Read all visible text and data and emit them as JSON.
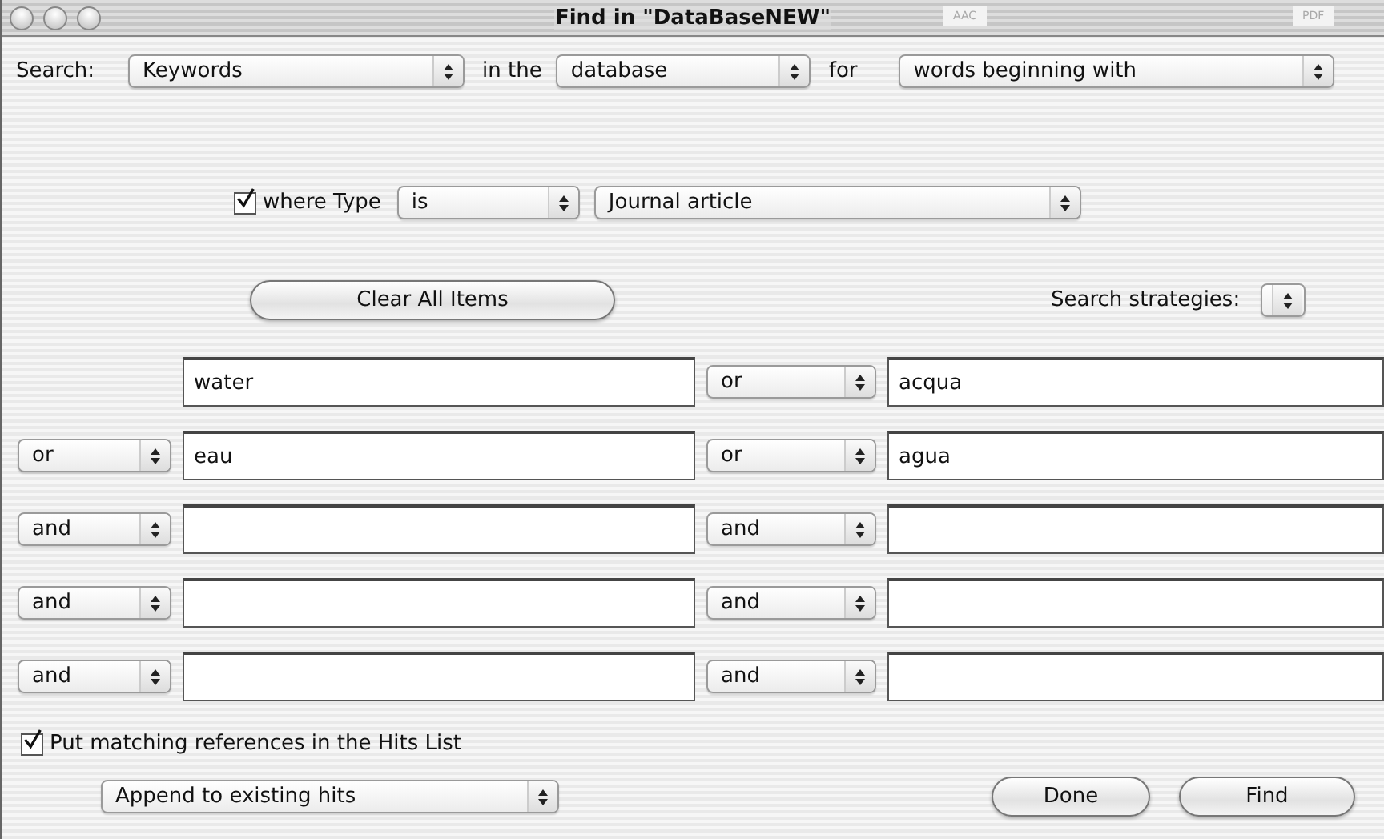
{
  "window": {
    "title": "Find in \"DataBaseNEW\"",
    "faded_labels": [
      "AAC",
      "PDF"
    ]
  },
  "search": {
    "label": "Search:",
    "field": "Keywords",
    "in_label": "in the",
    "scope": "database",
    "for_label": "for",
    "mode": "words beginning with"
  },
  "type_filter": {
    "checked": true,
    "label": "where Type",
    "operator": "is",
    "value": "Journal article"
  },
  "clear_button": "Clear All Items",
  "strategies": {
    "label": "Search strategies:"
  },
  "rows": [
    {
      "term": "water",
      "right_connector": "or",
      "right_term": "acqua"
    },
    {
      "connector": "or",
      "term": "eau",
      "right_connector": "or",
      "right_term": "agua"
    },
    {
      "connector": "and",
      "term": "",
      "right_connector": "and",
      "right_term": ""
    },
    {
      "connector": "and",
      "term": "",
      "right_connector": "and",
      "right_term": ""
    },
    {
      "connector": "and",
      "term": "",
      "right_connector": "and",
      "right_term": ""
    }
  ],
  "hits": {
    "checked": true,
    "label": "Put matching references in the Hits List",
    "action": "Append to existing hits"
  },
  "buttons": [
    {
      "label": "Done"
    },
    {
      "label": "Find"
    }
  ]
}
